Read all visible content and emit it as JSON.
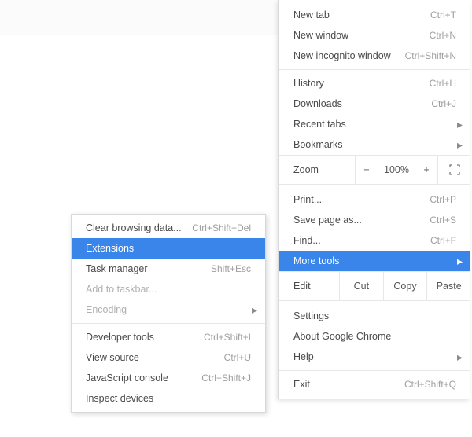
{
  "main_menu": {
    "group1": {
      "new_tab_label": "New tab",
      "new_tab_shortcut": "Ctrl+T",
      "new_window_label": "New window",
      "new_window_shortcut": "Ctrl+N",
      "incognito_label": "New incognito window",
      "incognito_shortcut": "Ctrl+Shift+N"
    },
    "group2": {
      "history_label": "History",
      "history_shortcut": "Ctrl+H",
      "downloads_label": "Downloads",
      "downloads_shortcut": "Ctrl+J",
      "recent_tabs_label": "Recent tabs",
      "bookmarks_label": "Bookmarks"
    },
    "zoom": {
      "label": "Zoom",
      "minus": "−",
      "value": "100%",
      "plus": "+"
    },
    "group3": {
      "print_label": "Print...",
      "print_shortcut": "Ctrl+P",
      "save_label": "Save page as...",
      "save_shortcut": "Ctrl+S",
      "find_label": "Find...",
      "find_shortcut": "Ctrl+F",
      "more_tools_label": "More tools"
    },
    "edit_bar": {
      "edit": "Edit",
      "cut": "Cut",
      "copy": "Copy",
      "paste": "Paste"
    },
    "group4": {
      "settings_label": "Settings",
      "about_label": "About Google Chrome",
      "help_label": "Help"
    },
    "group5": {
      "exit_label": "Exit",
      "exit_shortcut": "Ctrl+Shift+Q"
    }
  },
  "sub_menu": {
    "clear_label": "Clear browsing data...",
    "clear_shortcut": "Ctrl+Shift+Del",
    "extensions_label": "Extensions",
    "task_mgr_label": "Task manager",
    "task_mgr_shortcut": "Shift+Esc",
    "taskbar_label": "Add to taskbar...",
    "encoding_label": "Encoding",
    "devtools_label": "Developer tools",
    "devtools_shortcut": "Ctrl+Shift+I",
    "view_source_label": "View source",
    "view_source_shortcut": "Ctrl+U",
    "jsconsole_label": "JavaScript console",
    "jsconsole_shortcut": "Ctrl+Shift+J",
    "inspect_label": "Inspect devices"
  }
}
